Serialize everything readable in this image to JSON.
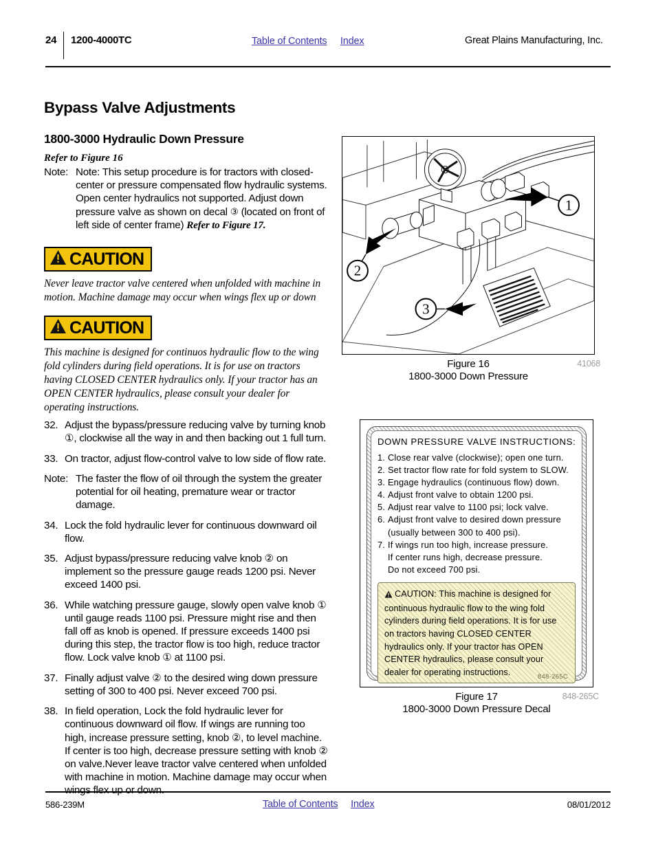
{
  "header": {
    "page_number": "24",
    "model": "1200-4000TC",
    "toc_link": "Table of Contents",
    "index_link": "Index",
    "company": "Great Plains Manufacturing, Inc."
  },
  "footer": {
    "doc_number": "586-239M",
    "toc_link": "Table of Contents",
    "index_link": "Index",
    "date": "08/01/2012"
  },
  "content": {
    "section_title": "Bypass Valve Adjustments",
    "subsection_title": "1800-3000 Hydraulic Down Pressure",
    "refer_line": "Refer to Figure 16",
    "intro_note": {
      "label": "Note:",
      "text_part1": "Note: This setup procedure is for tractors with closed-center or pressure compensated flow hydraulic systems. Open center hydraulics not supported. Adjust down pressure valve as shown on decal ",
      "callout": "③",
      "text_part2": " (located on front of left side of center frame) ",
      "refer_italic": "Refer to Figure 17."
    },
    "caution1": {
      "banner_label": "CAUTION",
      "body": "Never leave tractor valve centered when unfolded with machine in motion. Machine damage may occur when wings flex up or down"
    },
    "caution2": {
      "banner_label": "CAUTION",
      "body": "This machine is designed for continuos hydraulic flow to the wing fold cylinders during field operations. It is for use on tractors having CLOSED CENTER hydraulics only. If your tractor has an OPEN CENTER hydraulics, please consult your dealer for operating instructions."
    },
    "steps": [
      {
        "label": "32.",
        "text": "Adjust the bypass/pressure reducing valve by turning knob ①, clockwise all the way in and then backing out 1 full turn."
      },
      {
        "label": "33.",
        "text": "On tractor, adjust flow-control valve to low side of flow rate."
      },
      {
        "label": "Note:",
        "text": "The faster the flow of oil through the system the greater potential for oil heating, premature wear or tractor damage."
      },
      {
        "label": "34.",
        "text": "Lock the fold hydraulic lever for continuous downward oil flow."
      },
      {
        "label": "35.",
        "text": "Adjust bypass/pressure reducing valve knob ② on implement so the pressure gauge reads 1200 psi. Never exceed 1400 psi."
      },
      {
        "label": "36.",
        "text": "While watching pressure gauge, slowly open valve knob ① until gauge reads 1100 psi. Pressure might rise and then fall off as knob is opened. If pressure exceeds 1400 psi during this step, the tractor flow is too high, reduce tractor flow. Lock valve knob ① at 1100 psi."
      },
      {
        "label": "37.",
        "text": "Finally adjust valve ② to the desired wing down pressure setting of 300 to 400 psi. Never exceed 700 psi."
      },
      {
        "label": "38.",
        "text": "In field operation, Lock the fold hydraulic lever for continuous downward oil flow. If wings are running too high, increase pressure setting, knob ②, to level machine. If center is too high, decrease pressure setting with knob ② on valve.Never leave tractor valve centered when unfolded with machine in motion. Machine damage may occur when wings flex up or down."
      }
    ]
  },
  "figure16": {
    "caption_line1": "Figure 16",
    "caption_line2": "1800-3000 Down Pressure",
    "part_number": "41068",
    "callouts": [
      "1",
      "2",
      "3"
    ],
    "alt": "Line drawing of hydraulic valve manifold with pressure gauge, bypass knobs and down pressure decal"
  },
  "figure17": {
    "caption_line1": "Figure 17",
    "caption_line2": "1800-3000 Down Pressure Decal",
    "part_number": "848-265C",
    "decal": {
      "title": "DOWN PRESSURE VALVE INSTRUCTIONS:",
      "items": [
        {
          "num": "1.",
          "text": "Close rear valve (clockwise); open one turn."
        },
        {
          "num": "2.",
          "text": "Set tractor flow rate for fold system to SLOW."
        },
        {
          "num": "3.",
          "text": "Engage hydraulics (continuous flow) down."
        },
        {
          "num": "4.",
          "text": "Adjust front valve to obtain 1200 psi."
        },
        {
          "num": "5.",
          "text": "Adjust rear valve to 1100 psi; lock valve."
        },
        {
          "num": "6.",
          "text": "Adjust front valve to desired down pressure"
        },
        {
          "num": "7.",
          "text": "If wings run too high, increase pressure."
        }
      ],
      "item6_continuation": "(usually between 300 to 400 psi).",
      "item7_continuation_1": "If center runs high, decrease pressure.",
      "item7_continuation_2": "Do not exceed 700 psi.",
      "caution_label": "CAUTION:",
      "caution_text": "This machine is designed for continuous hydraulic flow to the wing fold cylinders during field operations.  It is for use on tractors having CLOSED CENTER hydraulics only.  If your tractor has OPEN CENTER hydraulics, please consult your dealer for operating instructions.",
      "decal_part_number": "848-265C"
    }
  },
  "colors": {
    "caution_yellow": "#f3c40d",
    "link_blue": "#3a36a8",
    "decal_caution_bg": "#f7f5d0",
    "part_number_gray": "#9d9d9d"
  }
}
